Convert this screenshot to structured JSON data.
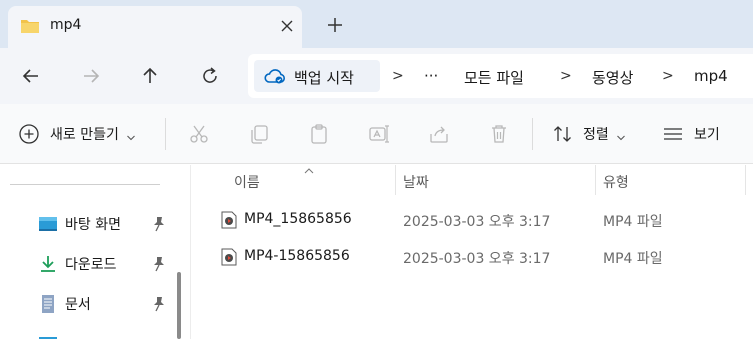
{
  "tab": {
    "title": "mp4",
    "icon": "folder-icon",
    "close_icon": "close-icon"
  },
  "new_tab_icon": "plus-icon",
  "nav": {
    "back_icon": "arrow-left-icon",
    "forward_icon": "arrow-right-icon",
    "up_icon": "arrow-up-icon",
    "refresh_icon": "refresh-icon"
  },
  "address": {
    "backup_label": "백업 시작",
    "overflow": "···",
    "crumbs": [
      "모든 파일",
      "동영상",
      "mp4"
    ],
    "separator": ">"
  },
  "toolbar": {
    "new_label": "새로 만들기",
    "sort_label": "정렬",
    "view_label": "보기"
  },
  "sidebar": {
    "items": [
      {
        "label": "바탕 화면",
        "icon": "desktop-icon",
        "pinned": true
      },
      {
        "label": "다운로드",
        "icon": "download-icon",
        "pinned": true
      },
      {
        "label": "문서",
        "icon": "document-icon",
        "pinned": true
      }
    ]
  },
  "filelist": {
    "columns": {
      "name": "이름",
      "date": "날짜",
      "type": "유형"
    },
    "rows": [
      {
        "name": "MP4_15865856",
        "date": "2025-03-03 오후 3:17",
        "type": "MP4 파일"
      },
      {
        "name": "MP4-15865856",
        "date": "2025-03-03 오후 3:17",
        "type": "MP4 파일"
      }
    ]
  },
  "colors": {
    "tabstrip": "#dde7f3",
    "accent": "#0067c0",
    "folder": "#f2c34a"
  }
}
